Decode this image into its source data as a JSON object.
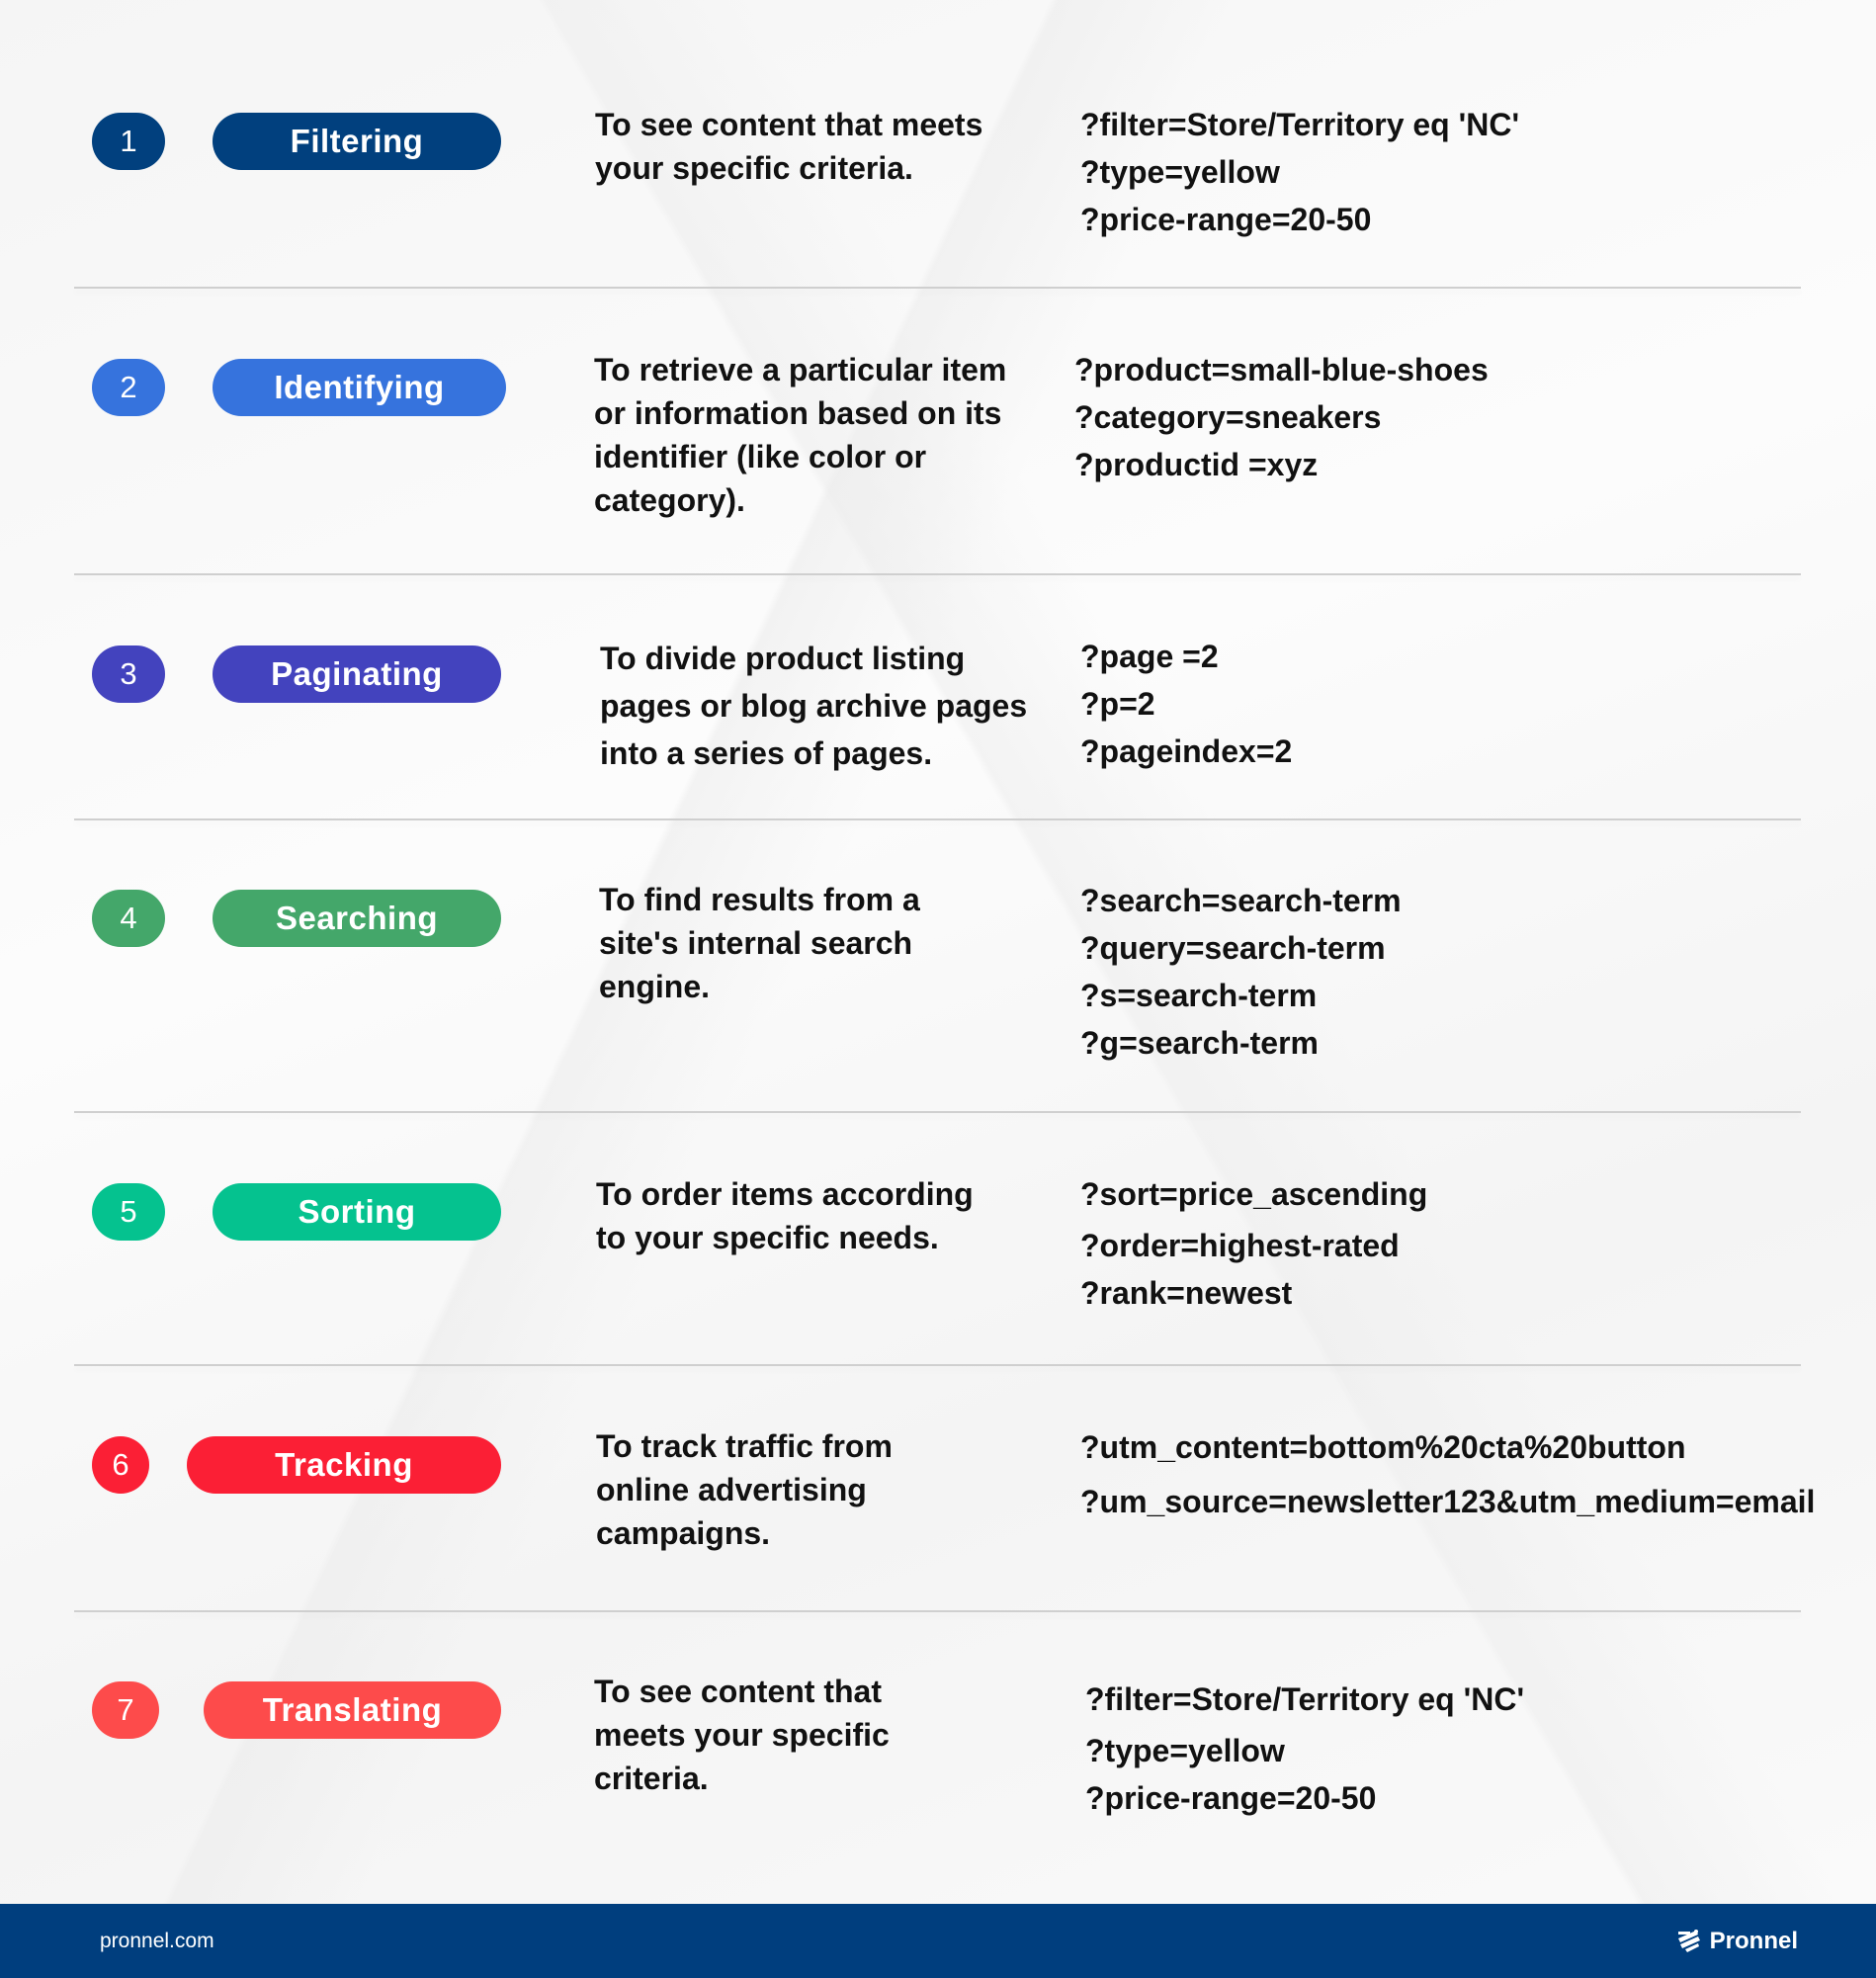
{
  "rows": [
    {
      "number": "1",
      "label": "Filtering",
      "color": "#01407e",
      "description": "To see content that meets your specific criteria.",
      "examples": [
        "?filter=Store/Territory eq 'NC'",
        "?type=yellow",
        "?price-range=20-50"
      ]
    },
    {
      "number": "2",
      "label": "Identifying",
      "color": "#3673dd",
      "description": "To retrieve a particular item or information based on its identifier (like color or category).",
      "examples": [
        "?product=small-blue-shoes",
        "?category=sneakers",
        "?productid =xyz"
      ]
    },
    {
      "number": "3",
      "label": "Paginating",
      "color": "#4343be",
      "description": "To divide product listing pages or blog archive pages into a series of pages.",
      "examples": [
        "?page =2",
        "?p=2",
        "?pageindex=2"
      ]
    },
    {
      "number": "4",
      "label": "Searching",
      "color": "#44a76a",
      "description": "To find results from a site's internal search engine.",
      "examples": [
        "?search=search-term",
        "?query=search-term",
        "?s=search-term",
        "?g=search-term"
      ]
    },
    {
      "number": "5",
      "label": "Sorting",
      "color": "#05c28f",
      "description": "To order items according to your specific needs.",
      "examples": [
        "?sort=price_ascending",
        "?order=highest-rated",
        "?rank=newest"
      ]
    },
    {
      "number": "6",
      "label": "Tracking",
      "color": "#fb1f35",
      "description": "To track traffic from online advertising campaigns.",
      "examples": [
        "?utm_content=bottom%20cta%20button",
        "?um_source=newsletter123&utm_medium=email"
      ]
    },
    {
      "number": "7",
      "label": "Translating",
      "color": "#fd4b4b",
      "description": "To see content that meets your specific criteria.",
      "examples": [
        "?filter=Store/Territory eq 'NC'",
        "?type=yellow",
        "?price-range=20-50"
      ]
    }
  ],
  "footer": {
    "site": "pronnel.com",
    "brand": "Pronnel",
    "brand_icon": "pronnel-logo-icon",
    "background": "#003e7e"
  }
}
